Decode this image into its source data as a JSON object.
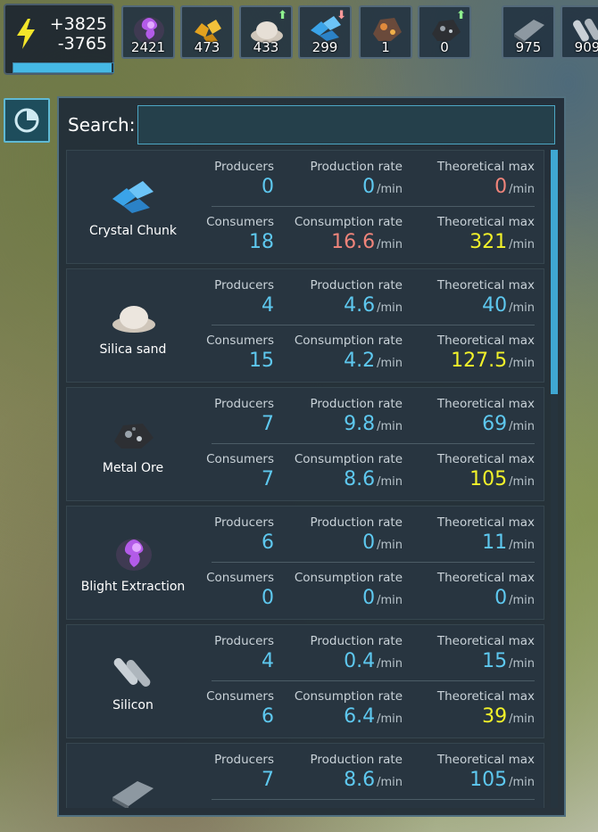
{
  "power": {
    "income": "+3825",
    "usage": "-3765",
    "fill_fraction": 0.98
  },
  "resources": [
    {
      "name": "blight-extraction",
      "value": "2421",
      "arrow": ""
    },
    {
      "name": "gold-nuggets",
      "value": "473",
      "arrow": ""
    },
    {
      "name": "silica-sand",
      "value": "433",
      "arrow": "up"
    },
    {
      "name": "crystal-chunk",
      "value": "299",
      "arrow": "down"
    },
    {
      "name": "copper-ore",
      "value": "1",
      "arrow": ""
    },
    {
      "name": "metal-ore",
      "value": "0",
      "arrow": "up"
    },
    {
      "name": "metal-plate",
      "value": "975",
      "arrow": ""
    },
    {
      "name": "silicon",
      "value": "909",
      "arrow": ""
    }
  ],
  "search": {
    "label": "Search:",
    "value": "",
    "placeholder": ""
  },
  "labels": {
    "producers": "Producers",
    "production_rate": "Production rate",
    "theoretical_max": "Theoretical max",
    "consumers": "Consumers",
    "consumption_rate": "Consumption rate",
    "unit": "/min"
  },
  "items": [
    {
      "name": "Crystal Chunk",
      "icon": "crystal-chunk-icon",
      "producers": "0",
      "production_rate": "0",
      "prod_max": "0",
      "consumers": "18",
      "consumption_rate": "16.6",
      "cons_max": "321",
      "prod_rate_color": "blue",
      "prod_max_color": "salmon",
      "cons_rate_color": "salmon",
      "cons_max_color": "yellow"
    },
    {
      "name": "Silica sand",
      "icon": "silica-sand-icon",
      "producers": "4",
      "production_rate": "4.6",
      "prod_max": "40",
      "consumers": "15",
      "consumption_rate": "4.2",
      "cons_max": "127.5",
      "prod_rate_color": "blue",
      "prod_max_color": "blue",
      "cons_rate_color": "blue",
      "cons_max_color": "yellow"
    },
    {
      "name": "Metal Ore",
      "icon": "metal-ore-icon",
      "producers": "7",
      "production_rate": "9.8",
      "prod_max": "69",
      "consumers": "7",
      "consumption_rate": "8.6",
      "cons_max": "105",
      "prod_rate_color": "blue",
      "prod_max_color": "blue",
      "cons_rate_color": "blue",
      "cons_max_color": "yellow"
    },
    {
      "name": "Blight Extraction",
      "icon": "blight-extraction-icon",
      "producers": "6",
      "production_rate": "0",
      "prod_max": "11",
      "consumers": "0",
      "consumption_rate": "0",
      "cons_max": "0",
      "prod_rate_color": "blue",
      "prod_max_color": "blue",
      "cons_rate_color": "blue",
      "cons_max_color": "blue"
    },
    {
      "name": "Silicon",
      "icon": "silicon-icon",
      "producers": "4",
      "production_rate": "0.4",
      "prod_max": "15",
      "consumers": "6",
      "consumption_rate": "6.4",
      "cons_max": "39",
      "prod_rate_color": "blue",
      "prod_max_color": "blue",
      "cons_rate_color": "blue",
      "cons_max_color": "yellow"
    },
    {
      "name": "",
      "icon": "metal-plate-icon",
      "producers": "7",
      "production_rate": "8.6",
      "prod_max": "105",
      "consumers": "",
      "consumption_rate": "",
      "cons_max": "",
      "prod_rate_color": "blue",
      "prod_max_color": "blue",
      "cons_rate_color": "blue",
      "cons_max_color": "blue"
    }
  ],
  "colors": {
    "blue": "#5ec8ef",
    "salmon": "#f0847a",
    "yellow": "#f2f22a",
    "accent": "#45b9e6"
  }
}
